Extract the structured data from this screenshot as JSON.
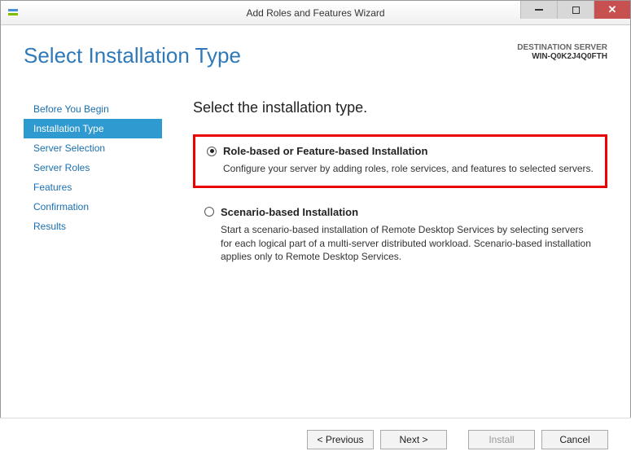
{
  "titlebar": {
    "title": "Add Roles and Features Wizard"
  },
  "page_title": "Select Installation Type",
  "destination": {
    "label": "DESTINATION SERVER",
    "name": "WIN-Q0K2J4Q0FTH"
  },
  "sidebar": {
    "items": [
      {
        "label": "Before You Begin",
        "active": false
      },
      {
        "label": "Installation Type",
        "active": true
      },
      {
        "label": "Server Selection",
        "active": false
      },
      {
        "label": "Server Roles",
        "active": false
      },
      {
        "label": "Features",
        "active": false
      },
      {
        "label": "Confirmation",
        "active": false
      },
      {
        "label": "Results",
        "active": false
      }
    ]
  },
  "main": {
    "instruction": "Select the installation type.",
    "options": [
      {
        "title": "Role-based or Feature-based Installation",
        "desc": "Configure your server by adding roles, role services, and features to selected servers.",
        "selected": true,
        "highlighted": true
      },
      {
        "title": "Scenario-based Installation",
        "desc": "Start a scenario-based installation of Remote Desktop Services by selecting servers for each logical part of a multi-server distributed workload. Scenario-based installation applies only to Remote Desktop Services.",
        "selected": false,
        "highlighted": false
      }
    ]
  },
  "footer": {
    "previous": "< Previous",
    "next": "Next >",
    "install": "Install",
    "cancel": "Cancel"
  }
}
